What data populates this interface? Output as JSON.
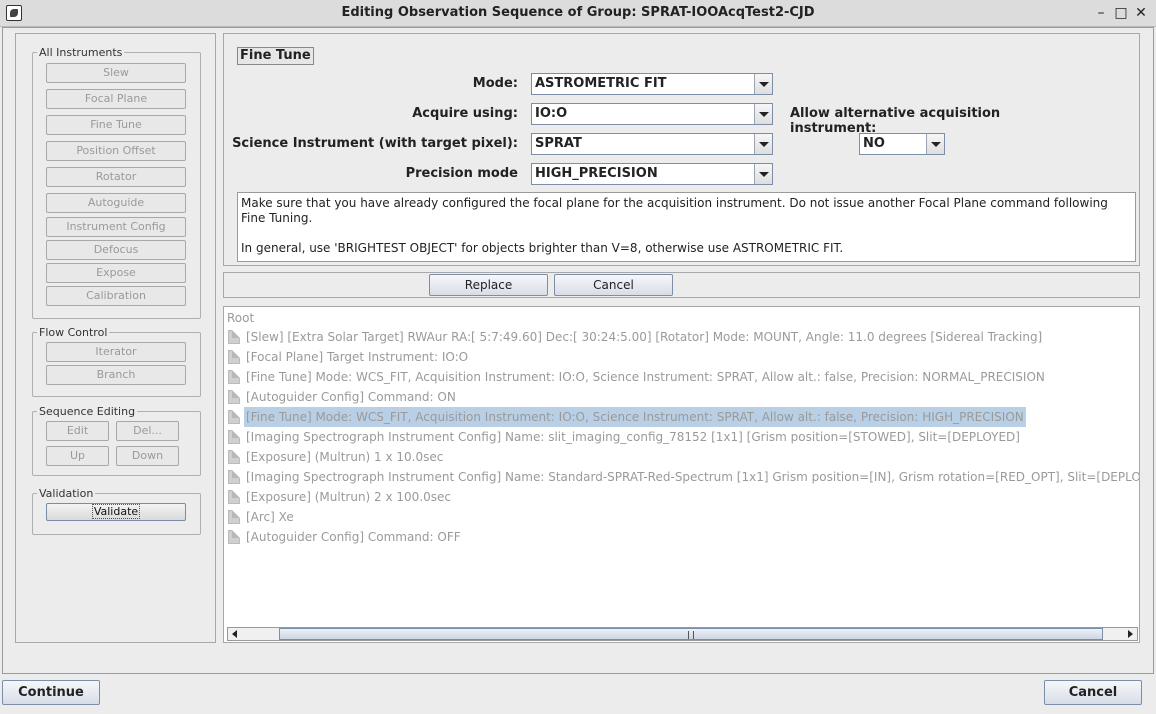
{
  "window": {
    "title": "Editing Observation Sequence of Group: SPRAT-IOOAcqTest2-CJD",
    "minimize": "–",
    "maximize": "□",
    "close": "✕"
  },
  "sidebar": {
    "all_instruments": {
      "legend": "All Instruments",
      "buttons": [
        "Slew",
        "Focal Plane",
        "Fine Tune",
        "Position Offset",
        "Rotator",
        "Autoguide",
        "Instrument Config",
        "Defocus",
        "Expose",
        "Calibration"
      ]
    },
    "flow_control": {
      "legend": "Flow Control",
      "buttons": [
        "Iterator",
        "Branch"
      ]
    },
    "sequence_editing": {
      "legend": "Sequence Editing",
      "buttons": [
        "Edit",
        "Del...",
        "Up",
        "Down"
      ]
    },
    "validation": {
      "legend": "Validation",
      "button": "Validate"
    }
  },
  "editor": {
    "section": "Fine Tune",
    "mode_label": "Mode:",
    "mode_value": "ASTROMETRIC FIT",
    "acquire_label": "Acquire using:",
    "acquire_value": "IO:O",
    "alt_label": "Allow alternative acquisition instrument:",
    "alt_value": "NO",
    "science_label": "Science Instrument (with target pixel):",
    "science_value": "SPRAT",
    "precision_label": "Precision mode",
    "precision_value": "HIGH_PRECISION",
    "notes": "Make sure that you have already configured the focal plane for the acquisition instrument. Do not issue another Focal Plane command following Fine Tuning.\n\nIn general, use 'BRIGHTEST OBJECT' for objects brighter than V=8, otherwise use ASTROMETRIC FIT."
  },
  "actions": {
    "replace": "Replace",
    "cancel": "Cancel"
  },
  "tree": {
    "root": "Root",
    "items": [
      "[Slew] [Extra Solar Target] RWAur RA:[ 5:7:49.60] Dec:[ 30:24:5.00] [Rotator] Mode: MOUNT, Angle: 11.0 degrees [Sidereal Tracking]",
      "[Focal Plane] Target Instrument: IO:O",
      "[Fine Tune] Mode: WCS_FIT, Acquisition Instrument: IO:O, Science Instrument: SPRAT, Allow alt.: false, Precision: NORMAL_PRECISION",
      "[Autoguider Config] Command: ON",
      "[Fine Tune] Mode: WCS_FIT, Acquisition Instrument: IO:O, Science Instrument: SPRAT, Allow alt.: false, Precision: HIGH_PRECISION",
      "[Imaging Spectrograph Instrument Config] Name: slit_imaging_config_78152 [1x1] [Grism position=[STOWED], Slit=[DEPLOYED]",
      "[Exposure] (Multrun) 1 x 10.0sec",
      "[Imaging Spectrograph Instrument Config] Name: Standard-SPRAT-Red-Spectrum [1x1] Grism position=[IN], Grism rotation=[RED_OPT], Slit=[DEPLOYED]",
      "[Exposure] (Multrun) 2 x 100.0sec",
      "[Arc] Xe",
      "[Autoguider Config] Command: OFF"
    ],
    "selected_index": 4
  },
  "footer": {
    "continue": "Continue",
    "cancel": "Cancel"
  }
}
